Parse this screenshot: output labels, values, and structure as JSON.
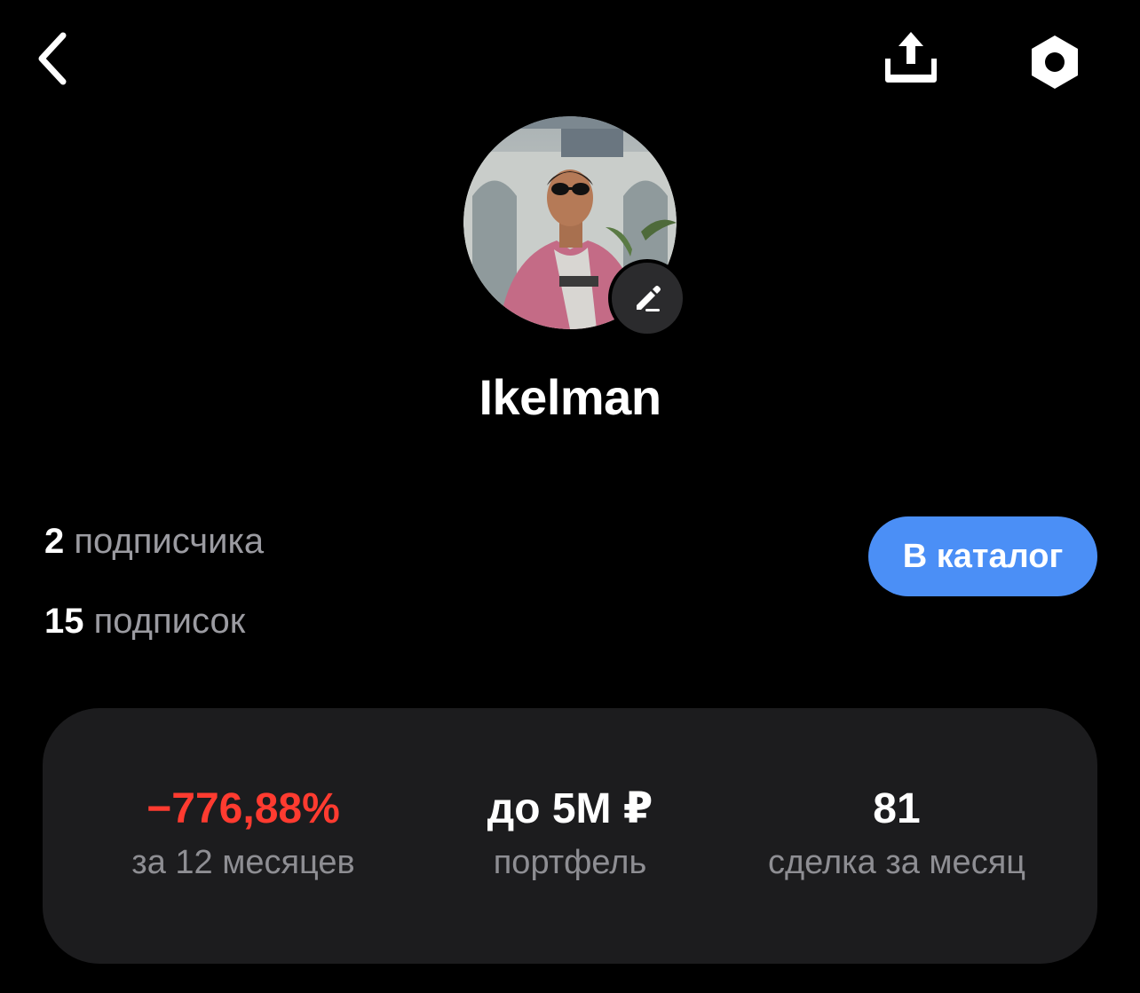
{
  "header": {
    "back_icon": "chevron-left-icon",
    "share_icon": "share-upload-icon",
    "settings_icon": "hexagon-settings-icon"
  },
  "profile": {
    "username": "Ikelman",
    "avatar": "profile-photo",
    "edit_icon": "pencil-icon"
  },
  "social": {
    "followers_count": "2",
    "followers_label": "подписчика",
    "following_count": "15",
    "following_label": "подписок"
  },
  "catalog_button": {
    "label": "В каталог",
    "color": "#4b8ff6"
  },
  "stats": [
    {
      "value": "−776,88%",
      "label": "за 12 месяцев",
      "color": "#ff3b30"
    },
    {
      "value": "до 5M ₽",
      "label": "портфель",
      "color": "#ffffff"
    },
    {
      "value": "81",
      "label": "сделка за месяц",
      "color": "#ffffff"
    }
  ]
}
